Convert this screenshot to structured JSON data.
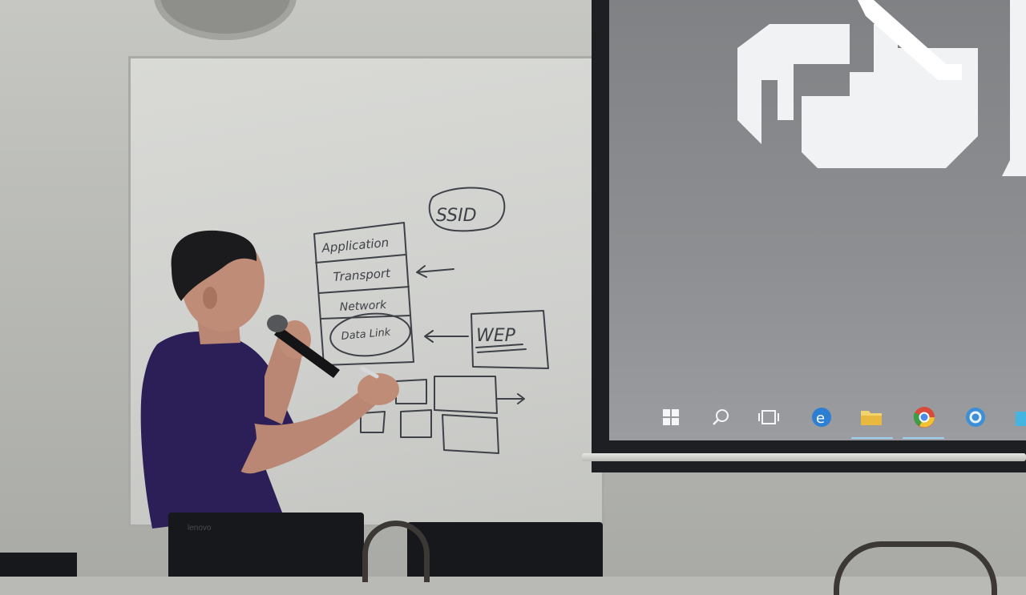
{
  "scene": {
    "description_tags": [
      "presenter",
      "whiteboard",
      "projector-screen",
      "microphone",
      "laptops",
      "chairs"
    ]
  },
  "whiteboard": {
    "ssid_label": "SSID",
    "osi_layers": [
      {
        "label": "Application"
      },
      {
        "label": "Transport"
      },
      {
        "label": "Network"
      },
      {
        "label": "Data Link"
      }
    ],
    "wep_label": "WEP"
  },
  "projector": {
    "taskbar_icons": [
      {
        "icon": "windows-start-icon"
      },
      {
        "icon": "search-icon"
      },
      {
        "icon": "task-view-icon"
      },
      {
        "icon": "edge-icon"
      },
      {
        "icon": "file-explorer-icon"
      },
      {
        "icon": "chrome-icon"
      },
      {
        "icon": "app-icon"
      },
      {
        "icon": "store-icon"
      }
    ]
  },
  "laptop": {
    "brand": "lenovo"
  },
  "colors": {
    "ink": "#3e4147",
    "shirt": "#2c1f58",
    "screen": "#8d8f92",
    "taskbar_underline": "#9ecff1"
  }
}
